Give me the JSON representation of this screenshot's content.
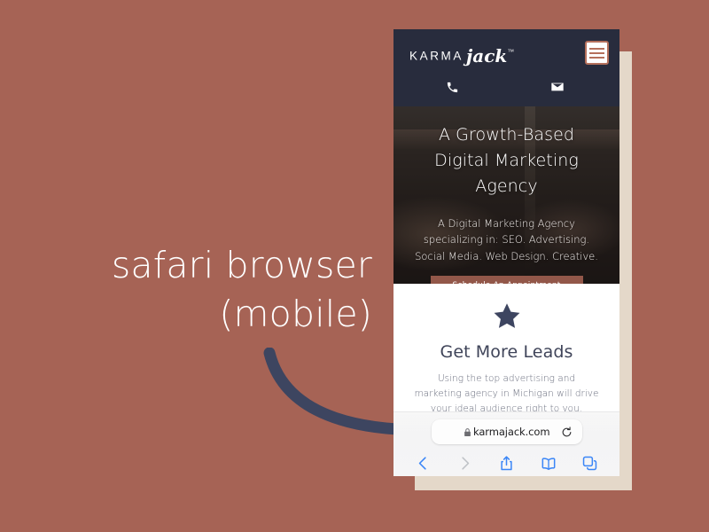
{
  "canvas": {
    "background_color": "#a66355",
    "accent_navy": "#282c3d",
    "accent_terracotta": "#b5705c",
    "beige_card_color": "#e4d8c9"
  },
  "annotation": {
    "text": "safari browser\n(mobile)",
    "color": "#ffffff",
    "arrow_icon": "curved-arrow-icon"
  },
  "phone": {
    "site_header": {
      "logo": {
        "word_one": "KARMA",
        "word_two": "jack",
        "trademark": "™"
      },
      "menu_button_icon": "hamburger-menu-icon",
      "contact_icons": [
        {
          "name": "phone-icon",
          "label": "Call"
        },
        {
          "name": "envelope-icon",
          "label": "Email"
        }
      ]
    },
    "hero": {
      "heading": "A Growth-Based\nDigital Marketing Agency",
      "subheading": "A Digital Marketing Agency specializing in: SEO. Advertising. Social Media. Web Design. Creative.",
      "cta_label": "Schedule An Appointment"
    },
    "leads_section": {
      "icon": "star-icon",
      "heading": "Get More Leads",
      "body": "Using the top advertising and marketing agency in Michigan will drive your ideal audience right to you."
    },
    "safari_chrome": {
      "url_bar": {
        "lock_icon": "lock-icon",
        "host": "karmajack.com",
        "reload_icon": "reload-icon"
      },
      "toolbar": [
        {
          "name": "back-icon",
          "label": "Back",
          "state": "enabled"
        },
        {
          "name": "forward-icon",
          "label": "Forward",
          "state": "disabled"
        },
        {
          "name": "share-icon",
          "label": "Share",
          "state": "enabled"
        },
        {
          "name": "bookmarks-icon",
          "label": "Bookmarks",
          "state": "enabled"
        },
        {
          "name": "tabs-icon",
          "label": "Tabs",
          "state": "enabled"
        }
      ]
    }
  }
}
